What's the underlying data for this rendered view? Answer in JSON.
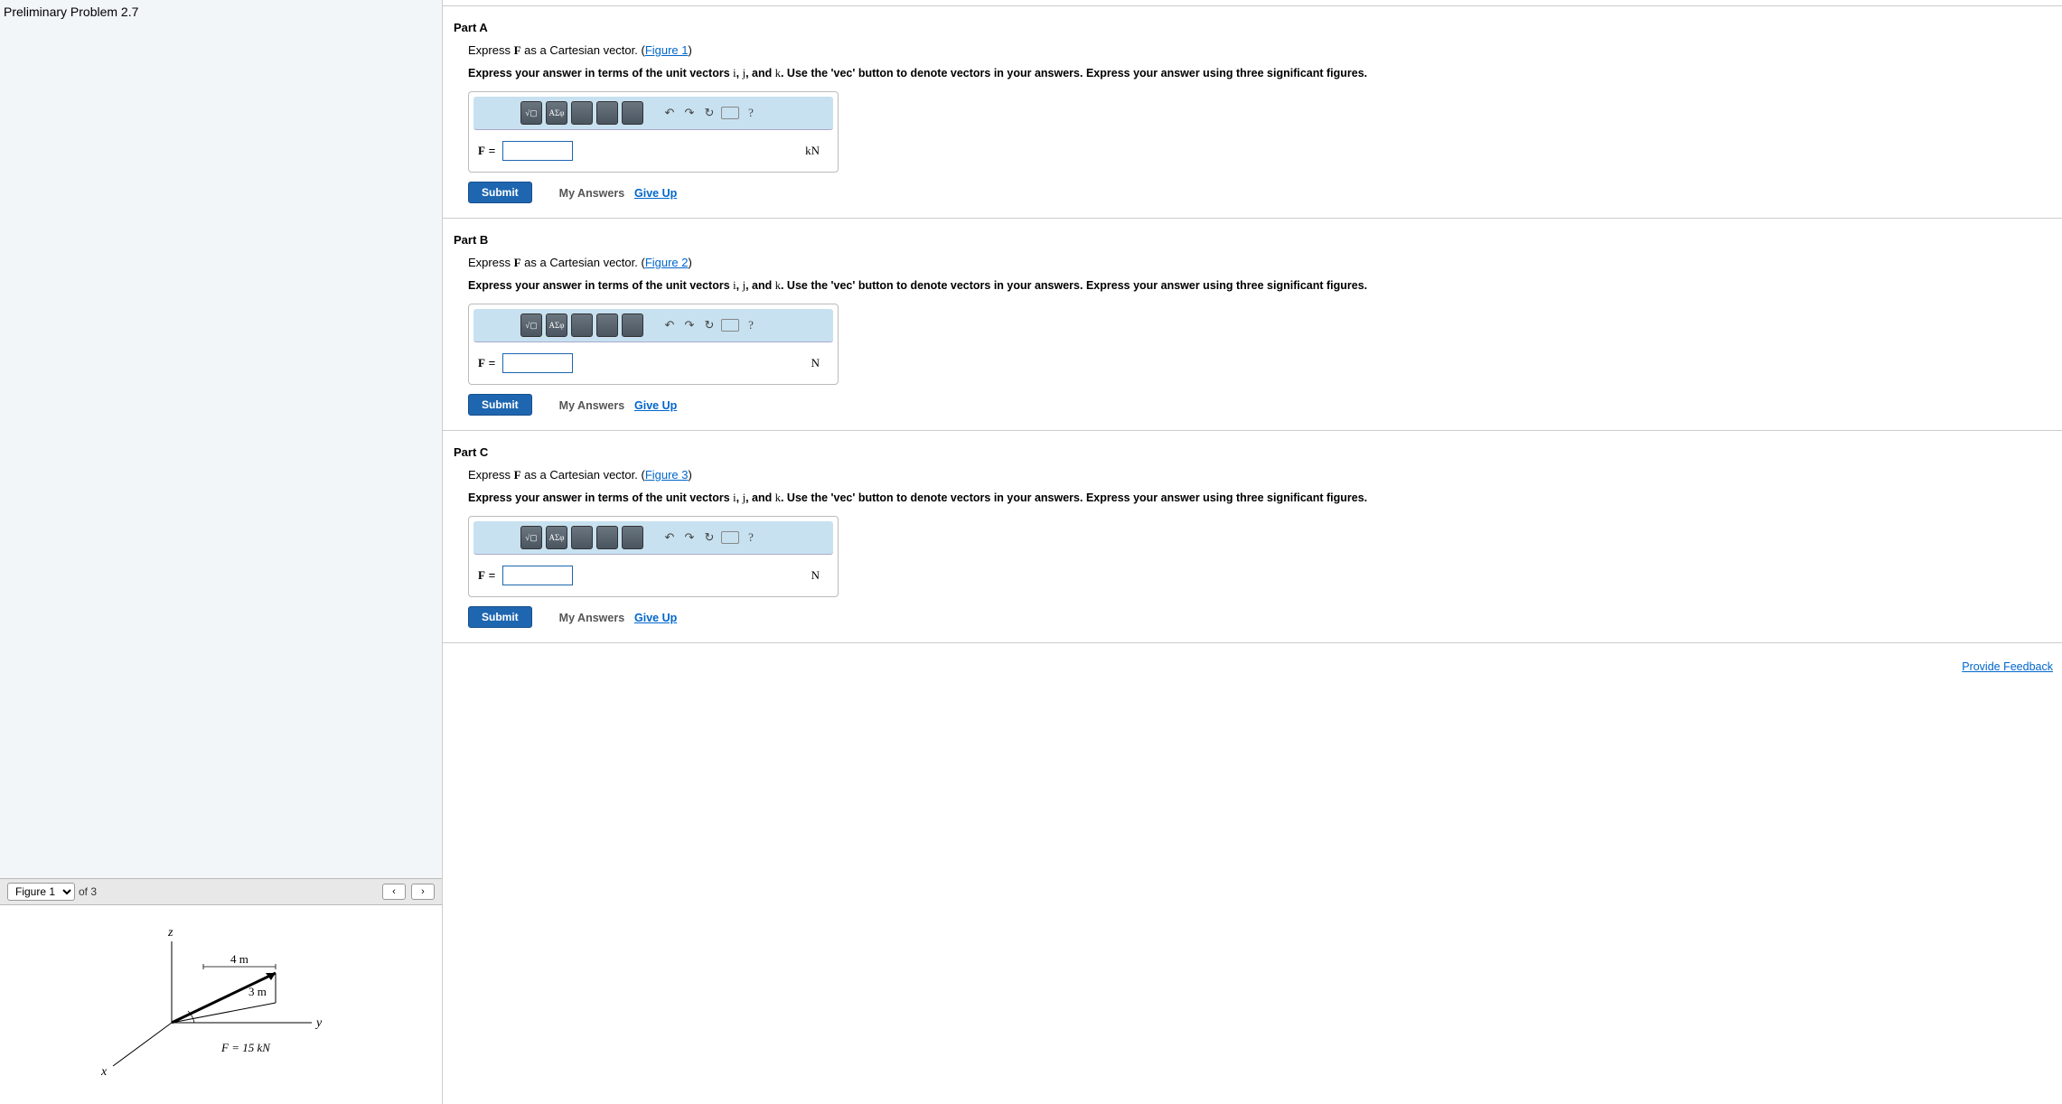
{
  "problem_title": "Preliminary Problem 2.7",
  "figure_nav": {
    "select_label": "Figure 1",
    "of_text": "of 3",
    "prev": "‹",
    "next": "›"
  },
  "figure": {
    "z_label": "z",
    "y_label": "y",
    "x_label": "x",
    "dim1": "4 m",
    "dim2": "3 m",
    "force": "F = 15 kN"
  },
  "parts": [
    {
      "title": "Part A",
      "prompt_pre": "Express ",
      "prompt_var": "F",
      "prompt_mid": " as a Cartesian vector. (",
      "figure_link": "Figure 1",
      "prompt_post": ")",
      "instruction_pre": "Express your answer in terms of the unit vectors ",
      "iv": "i",
      "jc": ", ",
      "jv": "j",
      "kc": ", and ",
      "kv": "k",
      "instruction_post": ". Use the 'vec' button to denote vectors in your answers. Express your answer using three significant figures.",
      "label": "F",
      "eq": " = ",
      "unit": "kN",
      "submit": "Submit",
      "my_answers": "My Answers",
      "give_up": "Give Up"
    },
    {
      "title": "Part B",
      "prompt_pre": "Express ",
      "prompt_var": "F",
      "prompt_mid": " as a Cartesian vector. (",
      "figure_link": "Figure 2",
      "prompt_post": ")",
      "instruction_pre": "Express your answer in terms of the unit vectors ",
      "iv": "i",
      "jc": ", ",
      "jv": "j",
      "kc": ", and ",
      "kv": "k",
      "instruction_post": ". Use the 'vec' button to denote vectors in your answers. Express your answer using three significant figures.",
      "label": "F",
      "eq": " = ",
      "unit": "N",
      "submit": "Submit",
      "my_answers": "My Answers",
      "give_up": "Give Up"
    },
    {
      "title": "Part C",
      "prompt_pre": "Express ",
      "prompt_var": "F",
      "prompt_mid": " as a Cartesian vector. (",
      "figure_link": "Figure 3",
      "prompt_post": ")",
      "instruction_pre": "Express your answer in terms of the unit vectors ",
      "iv": "i",
      "jc": ", ",
      "jv": "j",
      "kc": ", and ",
      "kv": "k",
      "instruction_post": ". Use the 'vec' button to denote vectors in your answers. Express your answer using three significant figures.",
      "label": "F",
      "eq": " = ",
      "unit": "N",
      "submit": "Submit",
      "my_answers": "My Answers",
      "give_up": "Give Up"
    }
  ],
  "toolbar": {
    "t1": "√▢",
    "t2": "ΑΣφ",
    "undo": "↶",
    "redo": "↷",
    "reset": "↻",
    "keyb": "⌨",
    "help": "?"
  },
  "feedback_link": "Provide Feedback"
}
